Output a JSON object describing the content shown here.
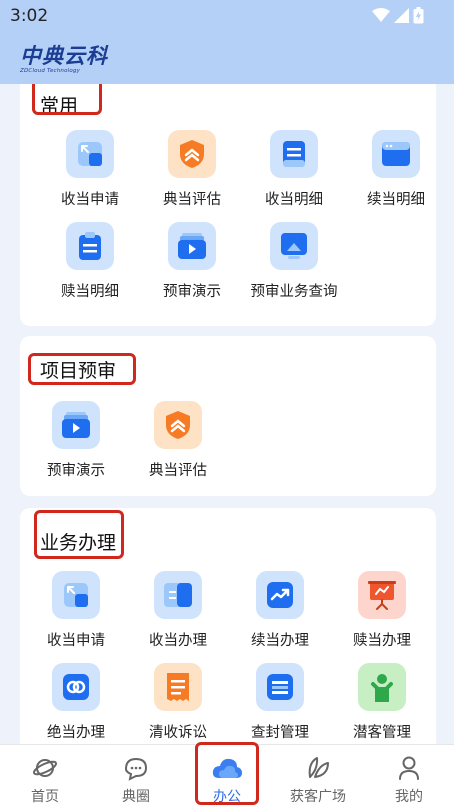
{
  "status_bar": {
    "time": "3:02",
    "icons": [
      "wifi-icon",
      "signal-icon",
      "battery-icon"
    ]
  },
  "header": {
    "logo_text": "中典云科",
    "logo_subtext": "ZDCloud Technology"
  },
  "sections": {
    "common": {
      "title": "常用",
      "items": [
        {
          "label": "收当申请",
          "icon": "arrow-square-icon"
        },
        {
          "label": "典当评估",
          "icon": "shield-chevron-icon"
        },
        {
          "label": "收当明细",
          "icon": "document-icon"
        },
        {
          "label": "续当明细",
          "icon": "window-icon"
        },
        {
          "label": "赎当明细",
          "icon": "clipboard-icon"
        },
        {
          "label": "预审演示",
          "icon": "play-folder-icon"
        },
        {
          "label": "预审业务查询",
          "icon": "monitor-icon"
        }
      ]
    },
    "preview": {
      "title": "项目预审",
      "items": [
        {
          "label": "预审演示",
          "icon": "play-folder-icon"
        },
        {
          "label": "典当评估",
          "icon": "shield-chevron-icon"
        }
      ]
    },
    "business": {
      "title": "业务办理",
      "items": [
        {
          "label": "收当申请",
          "icon": "arrow-square-icon"
        },
        {
          "label": "收当办理",
          "icon": "panel-icon"
        },
        {
          "label": "续当办理",
          "icon": "trend-icon"
        },
        {
          "label": "赎当办理",
          "icon": "easel-icon"
        },
        {
          "label": "绝当办理",
          "icon": "link-icon"
        },
        {
          "label": "清收诉讼",
          "icon": "receipt-icon"
        },
        {
          "label": "查封管理",
          "icon": "folder-icon"
        },
        {
          "label": "潜客管理",
          "icon": "person-icon"
        }
      ]
    }
  },
  "tabs": [
    {
      "label": "首页",
      "icon": "planet-icon",
      "active": false
    },
    {
      "label": "典圈",
      "icon": "chat-bubbles-icon",
      "active": false
    },
    {
      "label": "办公",
      "icon": "cloud-icon",
      "active": true
    },
    {
      "label": "获客广场",
      "icon": "leaf-icon",
      "active": false
    },
    {
      "label": "我的",
      "icon": "user-icon",
      "active": false
    }
  ],
  "colors": {
    "header_bg": "#b4d0f7",
    "accent": "#2d6ee8",
    "highlight": "#d0281c",
    "page_bg": "#eef2fb"
  }
}
